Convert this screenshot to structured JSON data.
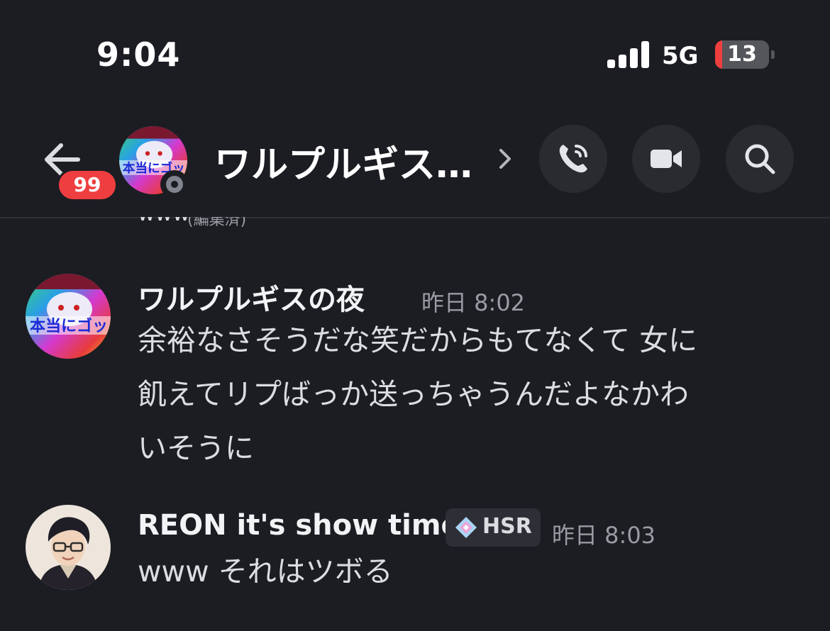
{
  "status_bar": {
    "time": "9:04",
    "network": "5G",
    "battery": "13",
    "battery_level": 0.13,
    "battery_color": "#ef3e3f"
  },
  "header": {
    "unread_badge": "99",
    "title": "ワルプルギス…",
    "avatar_caption": "本当にゴット"
  },
  "clipped_message": {
    "text": "www",
    "edited": "(編集済)"
  },
  "messages": [
    {
      "author": "ワルプルギスの夜",
      "timestamp": "昨日 8:02",
      "lines": [
        "余裕なさそうだな笑だからもてなくて 女に",
        "飢えてリプばっか送っちゃうんだよなかわ",
        "いそうに"
      ],
      "avatar_caption": "本当にゴット"
    },
    {
      "author": "REON it's show time",
      "tag": "HSR",
      "timestamp": "昨日 8:03",
      "lines": [
        "www それはツボる"
      ]
    }
  ],
  "icons": [
    "back-arrow-icon",
    "chevron-right-icon",
    "phone-icon",
    "video-camera-icon",
    "search-icon"
  ],
  "colors": {
    "background": "#1c1d22",
    "badge": "#ef3e3f",
    "button_bg": "#2a2b31",
    "muted_text": "#9b9ca3"
  }
}
